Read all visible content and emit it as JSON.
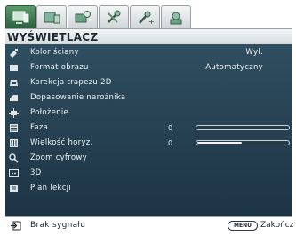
{
  "tabs": [
    {
      "icon": "display-monitor-icon",
      "active": true
    },
    {
      "icon": "picture-frame-icon",
      "active": false
    },
    {
      "icon": "picture-settings-icon",
      "active": false
    },
    {
      "icon": "system-tools-icon",
      "active": false
    },
    {
      "icon": "advanced-tools-icon",
      "active": false
    },
    {
      "icon": "information-icon",
      "active": false
    }
  ],
  "menu_title": "WYŚWIETLACZ",
  "items": [
    {
      "label": "Kolor ściany",
      "value": "Wył.",
      "icon": "wall-color-icon"
    },
    {
      "label": "Format obrazu",
      "value": "Automatyczny",
      "icon": "aspect-ratio-icon"
    },
    {
      "label": "Korekcja trapezu 2D",
      "icon": "keystone-icon"
    },
    {
      "label": "Dopasowanie narożnika",
      "icon": "corner-fit-icon"
    },
    {
      "label": "Położenie",
      "icon": "position-icon"
    },
    {
      "label": "Faza",
      "num": "0",
      "slider_fraction": 0,
      "icon": "phase-icon"
    },
    {
      "label": "Wielkość horyz.",
      "num": "0",
      "slider_fraction": 0.5,
      "icon": "h-size-icon"
    },
    {
      "label": "Zoom cyfrowy",
      "icon": "digital-zoom-icon"
    },
    {
      "label": "3D",
      "icon": "3d-icon"
    },
    {
      "label": "Plan lekcji",
      "icon": "teaching-template-icon"
    }
  ],
  "status": {
    "message": "Brak sygnału",
    "menu_key": "MENU",
    "exit_label": "Zakończ"
  },
  "colors": {
    "menu_bg": "#26404f",
    "active_tab": "#3f7d52",
    "text": "#f0f4f6"
  }
}
